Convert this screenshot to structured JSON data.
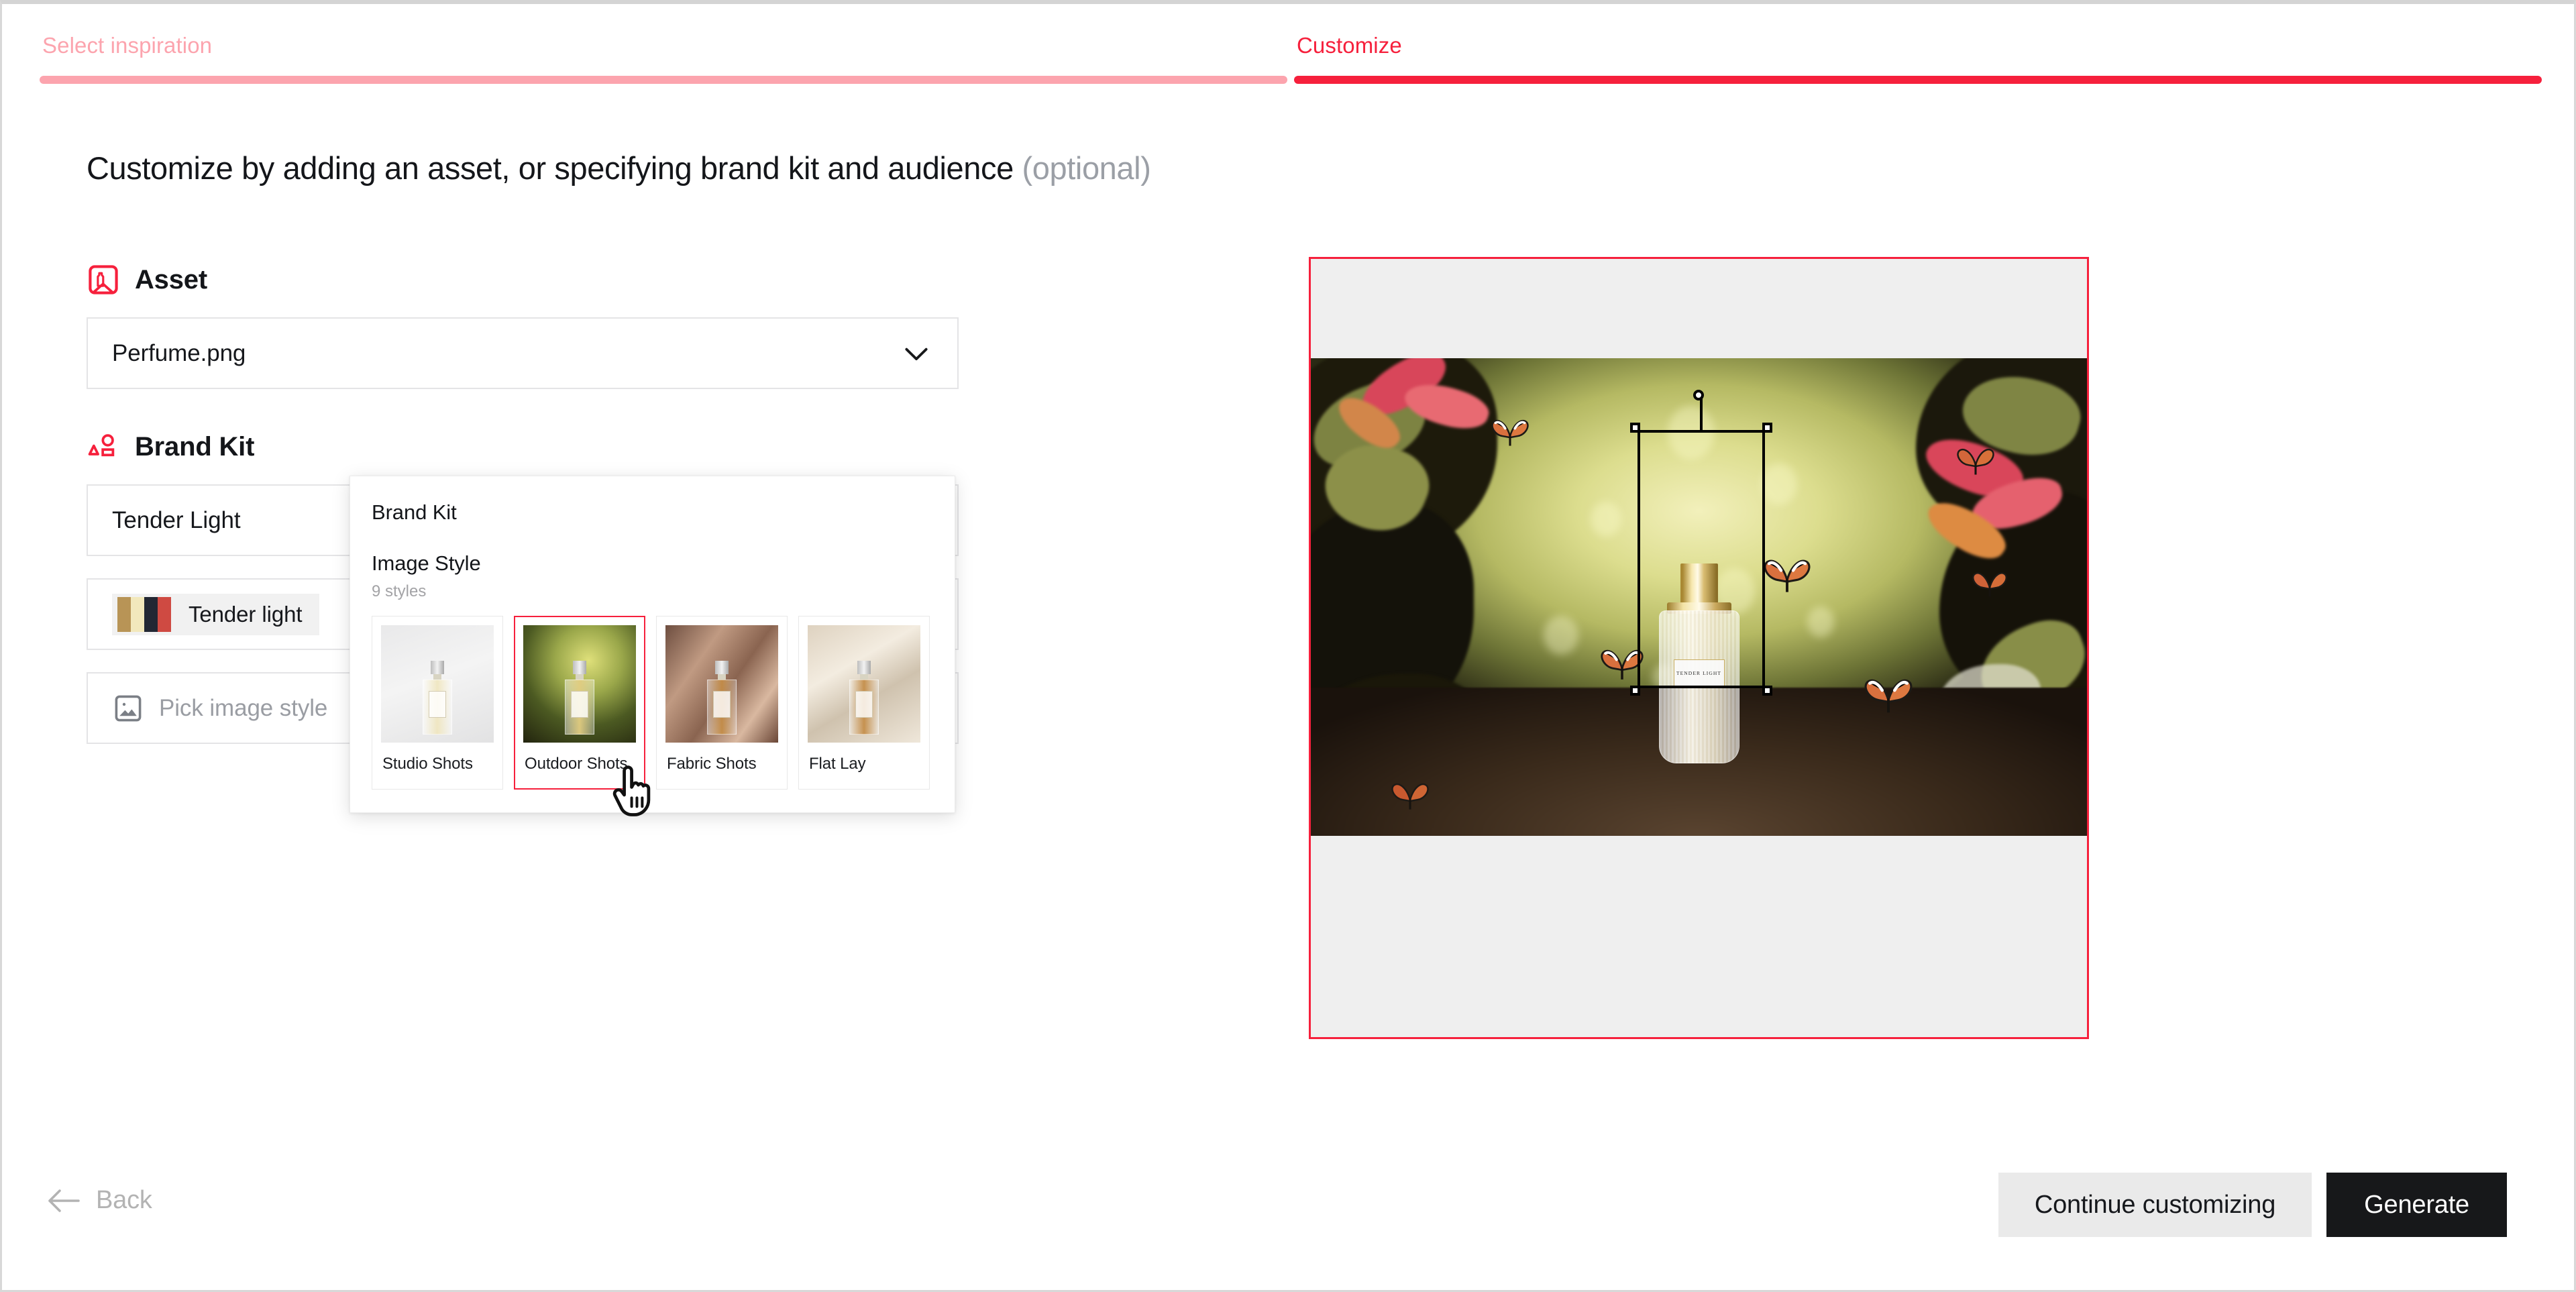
{
  "stepper": {
    "steps": [
      {
        "label": "Select inspiration",
        "state": "inactive"
      },
      {
        "label": "Customize",
        "state": "active"
      }
    ],
    "inactive_color": "#fca4ae",
    "active_color": "#f6203c"
  },
  "headline": {
    "main": "Customize by adding an asset, or specifying brand kit and audience",
    "optional": "(optional)"
  },
  "asset_section": {
    "title": "Asset",
    "icon": "asset-bottle-image-icon",
    "field_value": "Perfume.png",
    "chevron": "chevron-down-icon"
  },
  "brand_kit_section": {
    "title": "Brand Kit",
    "icon": "brand-shapes-icon",
    "name_field_value": "Tender Light",
    "palette_pill": {
      "label": "Tender light",
      "swatches": [
        "#b89456",
        "#f2e8bc",
        "#222733",
        "#cf4a42"
      ]
    },
    "image_style_field": {
      "icon": "image-icon",
      "placeholder": "Pick image style",
      "chevron": "chevron-down-icon"
    }
  },
  "popup": {
    "title": "Brand Kit",
    "subtitle": "Image Style",
    "count": "9 styles",
    "selected_style": "Outdoor Shots",
    "styles": [
      {
        "name": "Studio Shots",
        "thumb": "t-studio",
        "selected": false
      },
      {
        "name": "Outdoor Shots",
        "thumb": "t-outdoor",
        "selected": true
      },
      {
        "name": "Fabric Shots",
        "thumb": "t-fabric",
        "selected": false
      },
      {
        "name": "Flat Lay",
        "thumb": "t-flat",
        "selected": false
      }
    ]
  },
  "cursor": {
    "icon": "pointing-hand-cursor"
  },
  "preview": {
    "border_color": "#f6203c",
    "band_color": "#efefef",
    "product_label": "TENDER LIGHT",
    "selection": "object-selection-handles"
  },
  "footer": {
    "back_label": "Back",
    "back_icon": "arrow-left-icon",
    "continue_label": "Continue customizing",
    "generate_label": "Generate"
  }
}
